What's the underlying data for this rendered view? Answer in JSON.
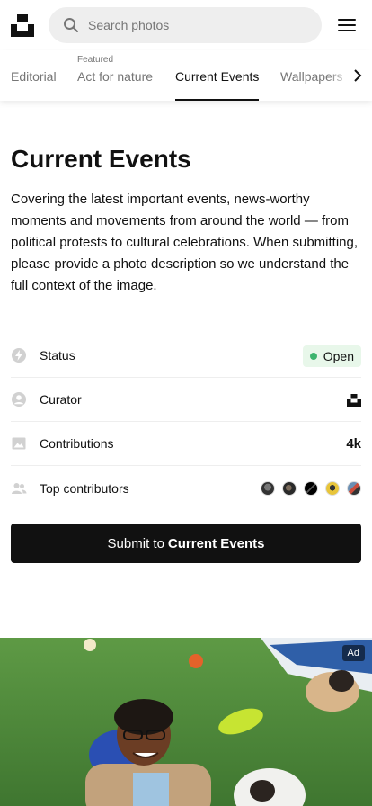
{
  "header": {
    "search_placeholder": "Search photos"
  },
  "tabs": [
    {
      "label": "Editorial",
      "kicker": ""
    },
    {
      "label": "Act for nature",
      "kicker": "Featured"
    },
    {
      "label": "Current Events",
      "kicker": ""
    },
    {
      "label": "Wallpapers",
      "kicker": ""
    }
  ],
  "topic": {
    "title": "Current Events",
    "description": "Covering the latest important events, news-worthy moments and movements from around the world — from political protests to cultural celebrations. When submitting, please provide a photo description so we understand the full context of the image."
  },
  "info": {
    "status_label": "Status",
    "status_value": "Open",
    "curator_label": "Curator",
    "contributions_label": "Contributions",
    "contributions_value": "4k",
    "top_contributors_label": "Top contributors"
  },
  "submit": {
    "prefix": "Submit to",
    "topic": "Current Events"
  },
  "ad": {
    "badge": "Ad"
  },
  "colors": {
    "accent": "#111111",
    "status_open": "#3cb46e"
  }
}
